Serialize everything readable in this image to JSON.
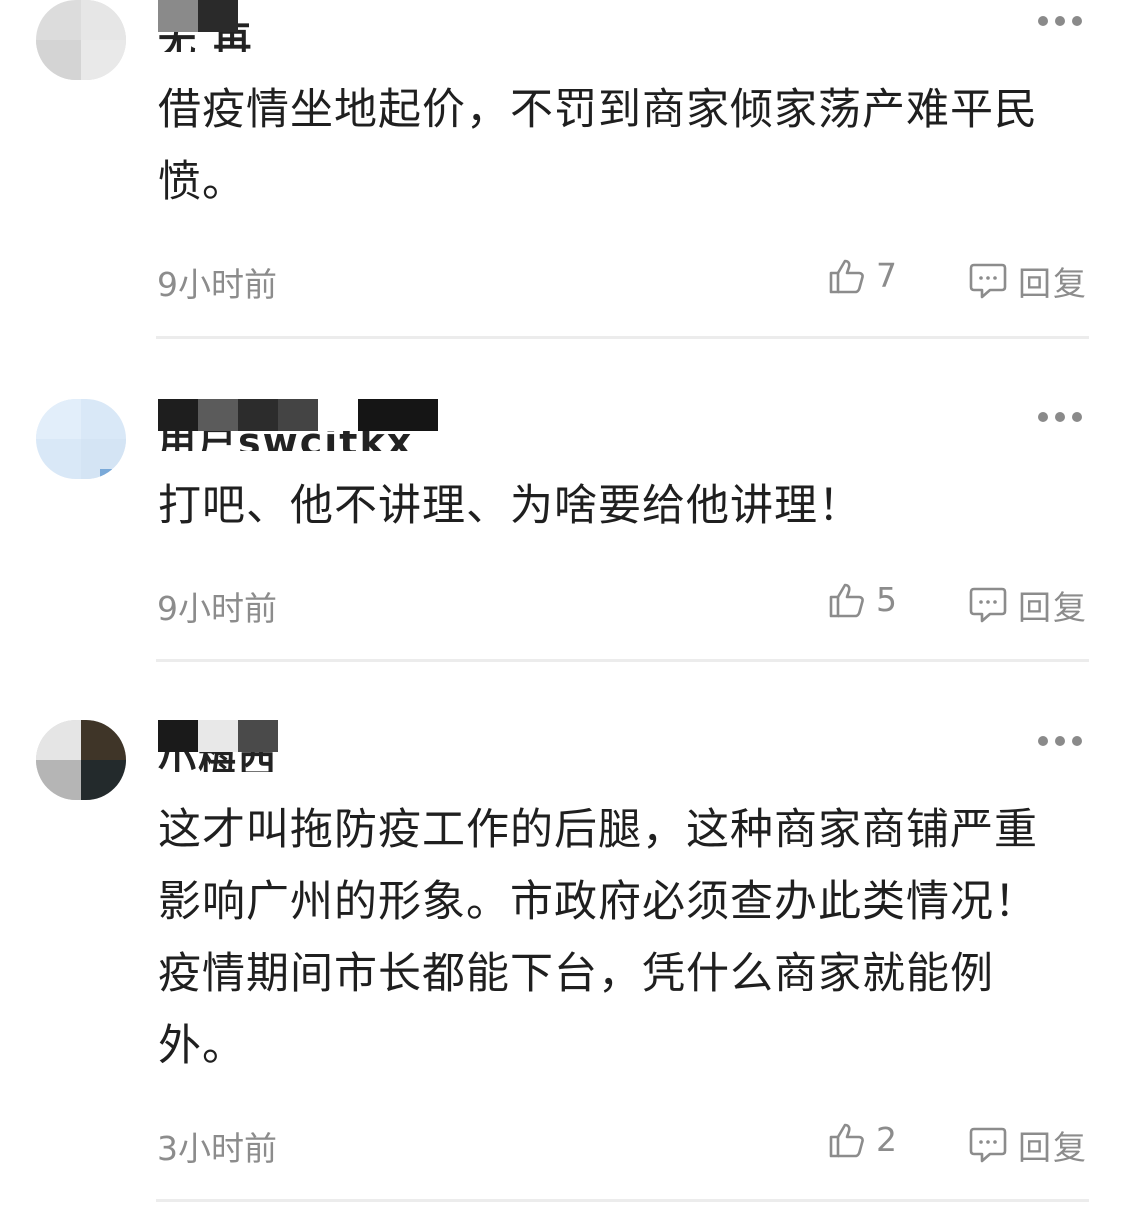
{
  "comments": [
    {
      "username": "无 再",
      "body": "借疫情坐地起价，不罚到商家倾家荡产难平民愤。",
      "time": "9小时前",
      "likes": "7",
      "reply_label": "回复",
      "more_icon": "more-dots-icon"
    },
    {
      "username": "用户swcjtkx",
      "body": "打吧、他不讲理、为啥要给他讲理！",
      "time": "9小时前",
      "likes": "5",
      "reply_label": "回复",
      "more_icon": "more-dots-icon"
    },
    {
      "username": "小梅西",
      "body": "这才叫拖防疫工作的后腿，这种商家商铺严重影响广州的形象。市政府必须查办此类情况！疫情期间市长都能下台，凭什么商家就能例外。",
      "time": "3小时前",
      "likes": "2",
      "reply_label": "回复",
      "more_icon": "more-dots-icon"
    }
  ],
  "colors": {
    "meta_text": "#8c8c8c",
    "body_text": "#1f1f1f",
    "divider": "#ececec"
  }
}
